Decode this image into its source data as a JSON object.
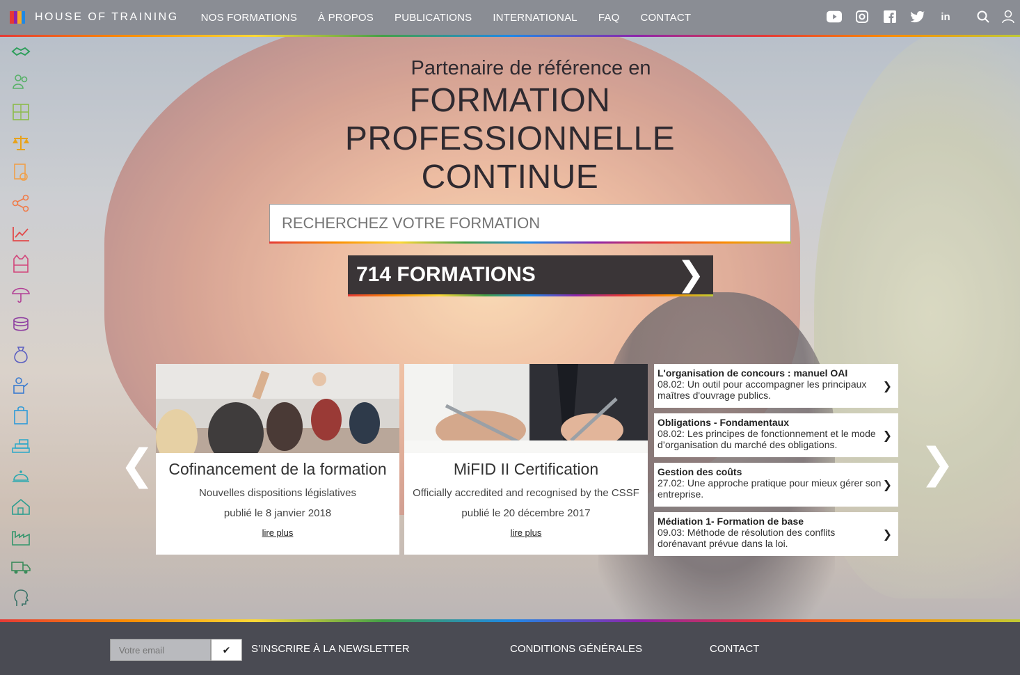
{
  "brand": {
    "name": "HOUSE OF TRAINING",
    "colors": [
      "#e53935",
      "#8e24aa",
      "#f9a825",
      "#1e88e5"
    ]
  },
  "nav": {
    "items": [
      "NOS FORMATIONS",
      "À PROPOS",
      "PUBLICATIONS",
      "INTERNATIONAL",
      "FAQ",
      "CONTACT"
    ]
  },
  "social": [
    "youtube-icon",
    "instagram-icon",
    "facebook-icon",
    "twitter-icon",
    "linkedin-icon"
  ],
  "tools": [
    "search-icon",
    "user-icon"
  ],
  "sidebar": {
    "icons": [
      {
        "name": "handshake-icon",
        "color": "#2e9e5b"
      },
      {
        "name": "people-icon",
        "color": "#58b168"
      },
      {
        "name": "calculator-icon",
        "color": "#8cbb4a"
      },
      {
        "name": "scales-icon",
        "color": "#e8a21a"
      },
      {
        "name": "document-check-icon",
        "color": "#f0a04a"
      },
      {
        "name": "share-network-icon",
        "color": "#f07c4a"
      },
      {
        "name": "chart-trend-icon",
        "color": "#e14b4b"
      },
      {
        "name": "safety-vest-icon",
        "color": "#d2457a"
      },
      {
        "name": "umbrella-icon",
        "color": "#b24096"
      },
      {
        "name": "coins-icon",
        "color": "#8e3ea1"
      },
      {
        "name": "money-bag-icon",
        "color": "#5b5fc1"
      },
      {
        "name": "presenter-icon",
        "color": "#3b7bd0"
      },
      {
        "name": "shopping-bag-icon",
        "color": "#2e9ad8"
      },
      {
        "name": "bricks-icon",
        "color": "#2aa7c9"
      },
      {
        "name": "cloche-icon",
        "color": "#28a8b0"
      },
      {
        "name": "house-icon",
        "color": "#2a9d8f"
      },
      {
        "name": "factory-icon",
        "color": "#33956b"
      },
      {
        "name": "truck-icon",
        "color": "#3b8b5a"
      },
      {
        "name": "head-profile-icon",
        "color": "#3a7268"
      }
    ]
  },
  "hero": {
    "subtitle": "Partenaire de référence en",
    "line1": "FORMATION",
    "line2": "PROFESSIONNELLE",
    "line3": "CONTINUE"
  },
  "search": {
    "placeholder": "RECHERCHEZ VOTRE FORMATION"
  },
  "formations_button": {
    "label": "714 FORMATIONS",
    "chevron": "❯"
  },
  "carousel": {
    "prev": "❮",
    "next": "❯",
    "cards": [
      {
        "title": "Cofinancement de la formation",
        "desc": "Nouvelles dispositions législatives",
        "date": "publié le 8 janvier 2018",
        "more": "lire plus"
      },
      {
        "title": "MiFID II Certification",
        "desc": "Officially accredited and recognised by the CSSF",
        "date": "publié le 20 décembre 2017",
        "more": "lire plus"
      }
    ],
    "news": [
      {
        "title": "L'organisation de concours : manuel OAI",
        "desc": "08.02: Un outil pour accompagner les principaux maîtres d'ouvrage publics."
      },
      {
        "title": "Obligations - Fondamentaux",
        "desc": "08.02: Les principes de fonctionnement et le mode d’organisation du marché des obligations."
      },
      {
        "title": "Gestion des coûts",
        "desc": "27.02: Une approche pratique pour mieux gérer son entreprise."
      },
      {
        "title": "Médiation 1- Formation de base",
        "desc": "09.03: Méthode de résolution des conflits dorénavant prévue dans la loi."
      }
    ]
  },
  "footer": {
    "email_placeholder": "Votre email",
    "submit": "✔",
    "newsletter": "S’INSCRIRE À LA NEWSLETTER",
    "conditions": "CONDITIONS GÉNÉRALES",
    "contact": "CONTACT"
  }
}
